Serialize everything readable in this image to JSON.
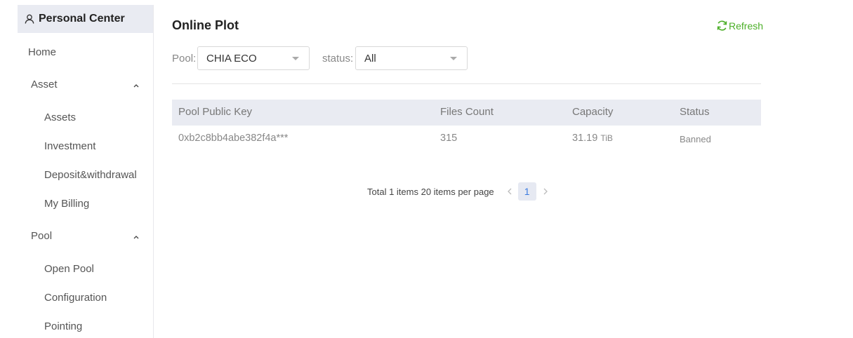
{
  "sidebar": {
    "header": "Personal Center",
    "items": [
      {
        "label": "Home"
      },
      {
        "label": "Asset"
      },
      {
        "label": "Assets"
      },
      {
        "label": "Investment"
      },
      {
        "label": "Deposit&withdrawal"
      },
      {
        "label": "My Billing"
      },
      {
        "label": "Pool"
      },
      {
        "label": "Open Pool"
      },
      {
        "label": "Configuration"
      },
      {
        "label": "Pointing"
      }
    ]
  },
  "main": {
    "title": "Online Plot",
    "refresh_label": "Refresh",
    "filters": {
      "pool_label": "Pool:",
      "pool_value": "CHIA ECO",
      "status_label": "status:",
      "status_value": "All"
    },
    "table": {
      "headers": [
        "Pool Public Key",
        "Files Count",
        "Capacity",
        "Status"
      ],
      "rows": [
        {
          "key": "0xb2c8bb4abe382f4a***",
          "files": "315",
          "capacity": "31.19",
          "unit": "TiB",
          "status": "Banned"
        }
      ]
    },
    "pagination": {
      "summary": "Total 1 items 20 items per page",
      "current_page": "1"
    }
  },
  "colors": {
    "accent_green": "#4caf28",
    "page_active_blue": "#3b7be0",
    "header_bg": "#e9ebf2"
  }
}
